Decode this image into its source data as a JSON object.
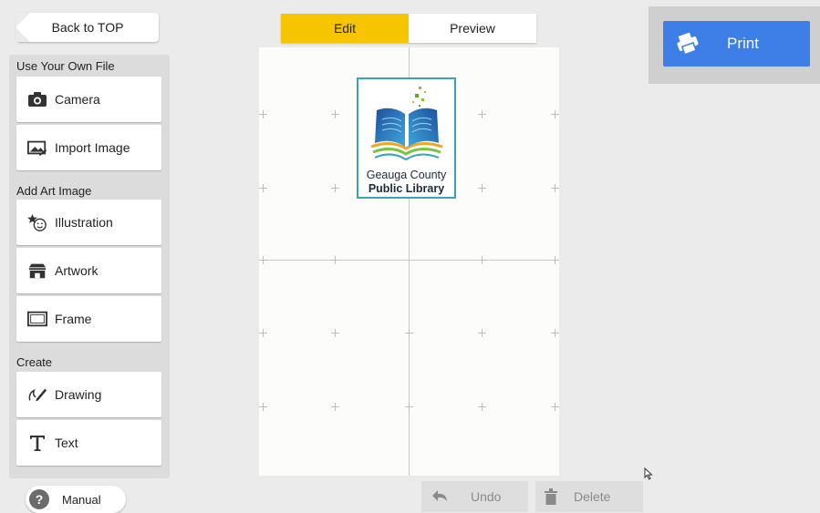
{
  "back_button": {
    "label": "Back to TOP"
  },
  "tabs": [
    {
      "label": "Edit",
      "active": true
    },
    {
      "label": "Preview",
      "active": false
    }
  ],
  "sections": {
    "own_file": {
      "label": "Use Your Own File",
      "items": [
        {
          "label": "Camera",
          "icon": "camera-icon"
        },
        {
          "label": "Import Image",
          "icon": "import-image-icon"
        }
      ]
    },
    "art_image": {
      "label": "Add Art Image",
      "items": [
        {
          "label": "Illustration",
          "icon": "illustration-icon"
        },
        {
          "label": "Artwork",
          "icon": "artwork-icon"
        },
        {
          "label": "Frame",
          "icon": "frame-icon"
        }
      ]
    },
    "create": {
      "label": "Create",
      "items": [
        {
          "label": "Drawing",
          "icon": "drawing-icon"
        },
        {
          "label": "Text",
          "icon": "text-icon"
        }
      ]
    }
  },
  "canvas": {
    "logo": {
      "line1": "Geauga County",
      "line2": "Public Library"
    }
  },
  "print": {
    "label": "Print",
    "icon": "printer-icon"
  },
  "bottom": {
    "manual": {
      "label": "Manual",
      "icon": "help-icon"
    },
    "undo": {
      "label": "Undo",
      "icon": "undo-icon"
    },
    "delete": {
      "label": "Delete",
      "icon": "trash-icon"
    }
  },
  "colors": {
    "accent": "#f7c400",
    "print": "#3d7fe6",
    "selection": "#3aa3b5"
  }
}
